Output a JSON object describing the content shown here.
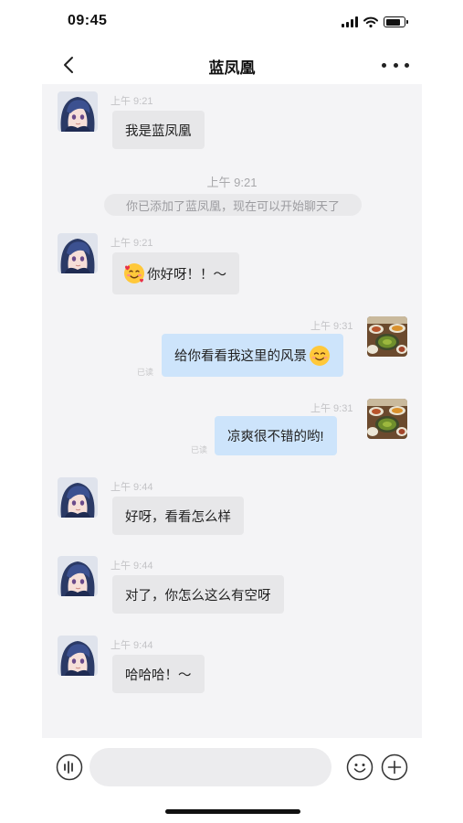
{
  "status_bar": {
    "time": "09:45"
  },
  "nav": {
    "title": "蓝凤凰"
  },
  "messages": [
    {
      "time": "上午 9:21",
      "text": "我是蓝凤凰"
    },
    {
      "time": "上午 9:21",
      "text": "你好呀！！～"
    },
    {
      "time": "上午 9:31",
      "text": "给你看看我这里的风景",
      "read": "已读"
    },
    {
      "time": "上午 9:31",
      "text": "凉爽很不错的哟!",
      "read": "已读"
    },
    {
      "time": "上午 9:44",
      "text": "好呀，看看怎么样"
    },
    {
      "time": "上午 9:44",
      "text": "对了，你怎么这么有空呀"
    },
    {
      "time": "上午 9:44",
      "text": "哈哈哈！～"
    }
  ],
  "system": {
    "time": "上午 9:21",
    "notice": "你已添加了蓝凤凰，现在可以开始聊天了"
  },
  "input_bar": {
    "value": "",
    "placeholder": ""
  },
  "icons": {
    "contact_avatar": "anime-girl-avatar",
    "my_avatar": "food-plate-avatar",
    "heart_emoji": "smiling-face-with-hearts",
    "smile_emoji": "smiling-face"
  },
  "colors": {
    "incoming_bubble": "#e7e7e9",
    "outgoing_bubble": "#cde4fb",
    "chat_background": "#f4f4f6"
  }
}
